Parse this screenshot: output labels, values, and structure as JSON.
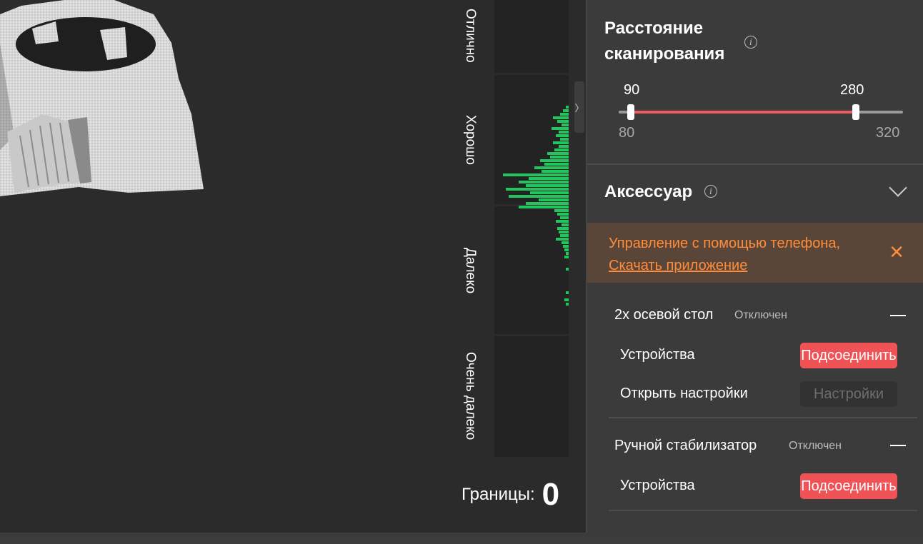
{
  "viewport": {
    "zones": [
      "Отлично",
      "Хорошо",
      "Далеко",
      "Очень далеко"
    ],
    "histogram_color": "#22c55e",
    "bounds_label": "Границы:",
    "bounds_value": "0",
    "collapse_icon": "chevron-right-icon"
  },
  "panel": {
    "scan_distance": {
      "title_line1": "Расстояние",
      "title_line2": "сканирования",
      "info_icon": "info-icon",
      "value_low": "90",
      "value_high": "280",
      "min": "80",
      "max": "320",
      "low": 90,
      "high": 280,
      "range_min": 80,
      "range_max": 320,
      "accent": "#ef5b5e"
    },
    "accessory": {
      "title": "Аксессуар",
      "notice_text": "Управление с помощью телефона,",
      "notice_link": "Скачать приложение",
      "notice_color": "#ff8c3a",
      "items": [
        {
          "name": "2х осевой стол",
          "status": "Отключен",
          "devices_label": "Устройства",
          "connect_label": "Подсоединить",
          "settings_label": "Открыть настройки",
          "settings_button": "Настройки"
        },
        {
          "name": "Ручной стабилизатор",
          "status": "Отключен",
          "devices_label": "Устройства",
          "connect_label": "Подсоединить"
        }
      ]
    }
  }
}
